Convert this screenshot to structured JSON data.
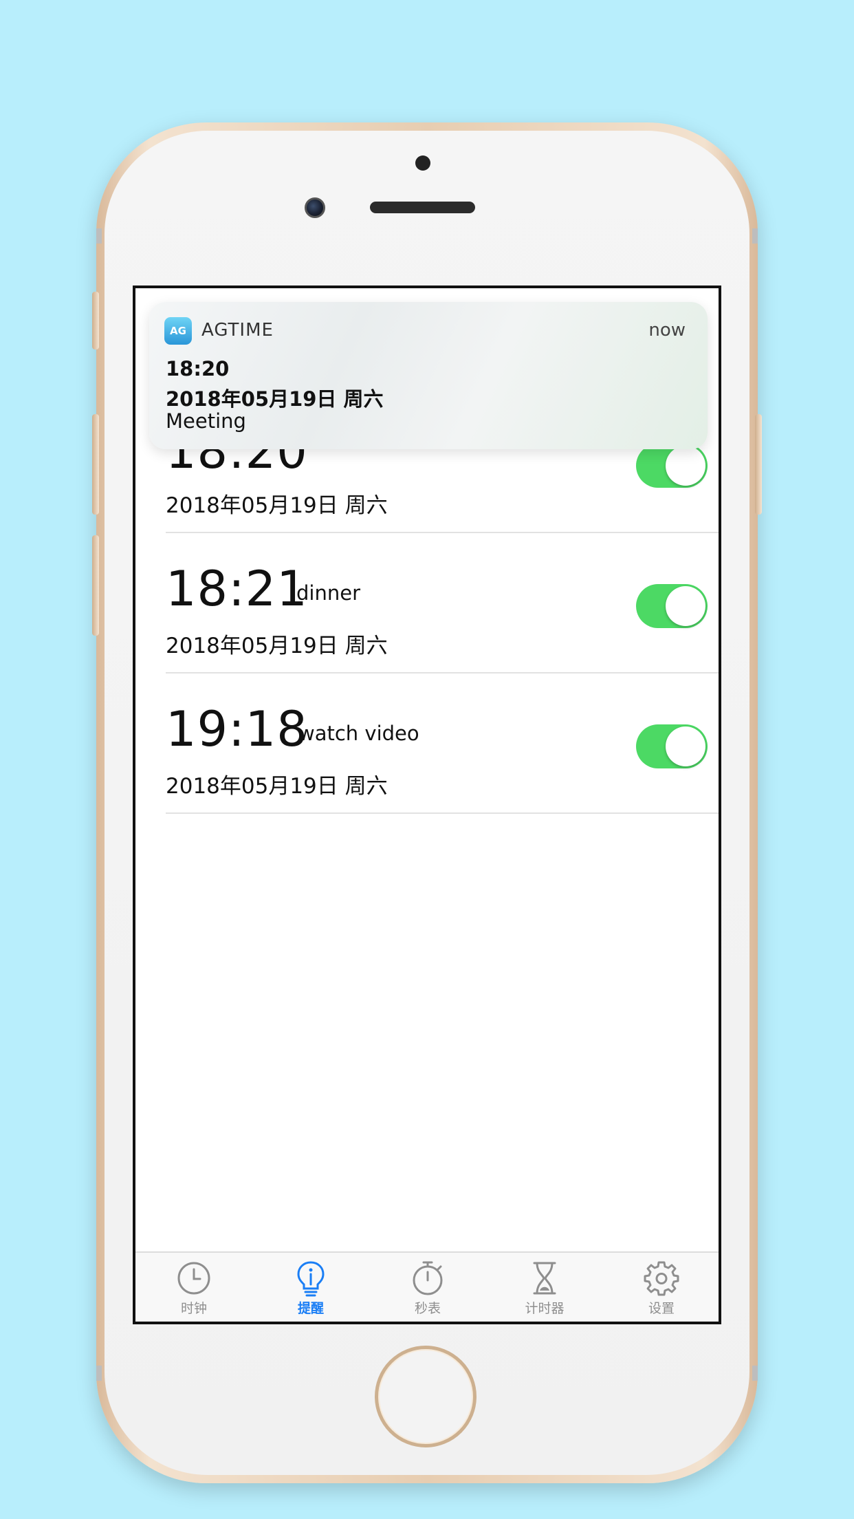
{
  "notification": {
    "app_icon_text": "AG",
    "app_name": "AGTIME",
    "time": "now",
    "title": "18:20",
    "subtitle": "2018年05月19日  周六",
    "body": "Meeting"
  },
  "alarms": [
    {
      "time": "18:20",
      "label": "",
      "date": "2018年05月19日  周六",
      "enabled": true
    },
    {
      "time": "18:21",
      "label": "dinner",
      "date": "2018年05月19日  周六",
      "enabled": true
    },
    {
      "time": "19:18",
      "label": "watch video",
      "date": "2018年05月19日  周六",
      "enabled": true
    }
  ],
  "tabs": [
    {
      "label": "时钟",
      "icon": "clock-icon",
      "active": false
    },
    {
      "label": "提醒",
      "icon": "lightbulb-icon",
      "active": true
    },
    {
      "label": "秒表",
      "icon": "stopwatch-icon",
      "active": false
    },
    {
      "label": "计时器",
      "icon": "hourglass-icon",
      "active": false
    },
    {
      "label": "设置",
      "icon": "gear-icon",
      "active": false
    }
  ],
  "colors": {
    "background": "#b8eefc",
    "toggle_on": "#4cd964",
    "tab_active": "#1a7ef5",
    "tab_inactive": "#8e8e8e"
  }
}
